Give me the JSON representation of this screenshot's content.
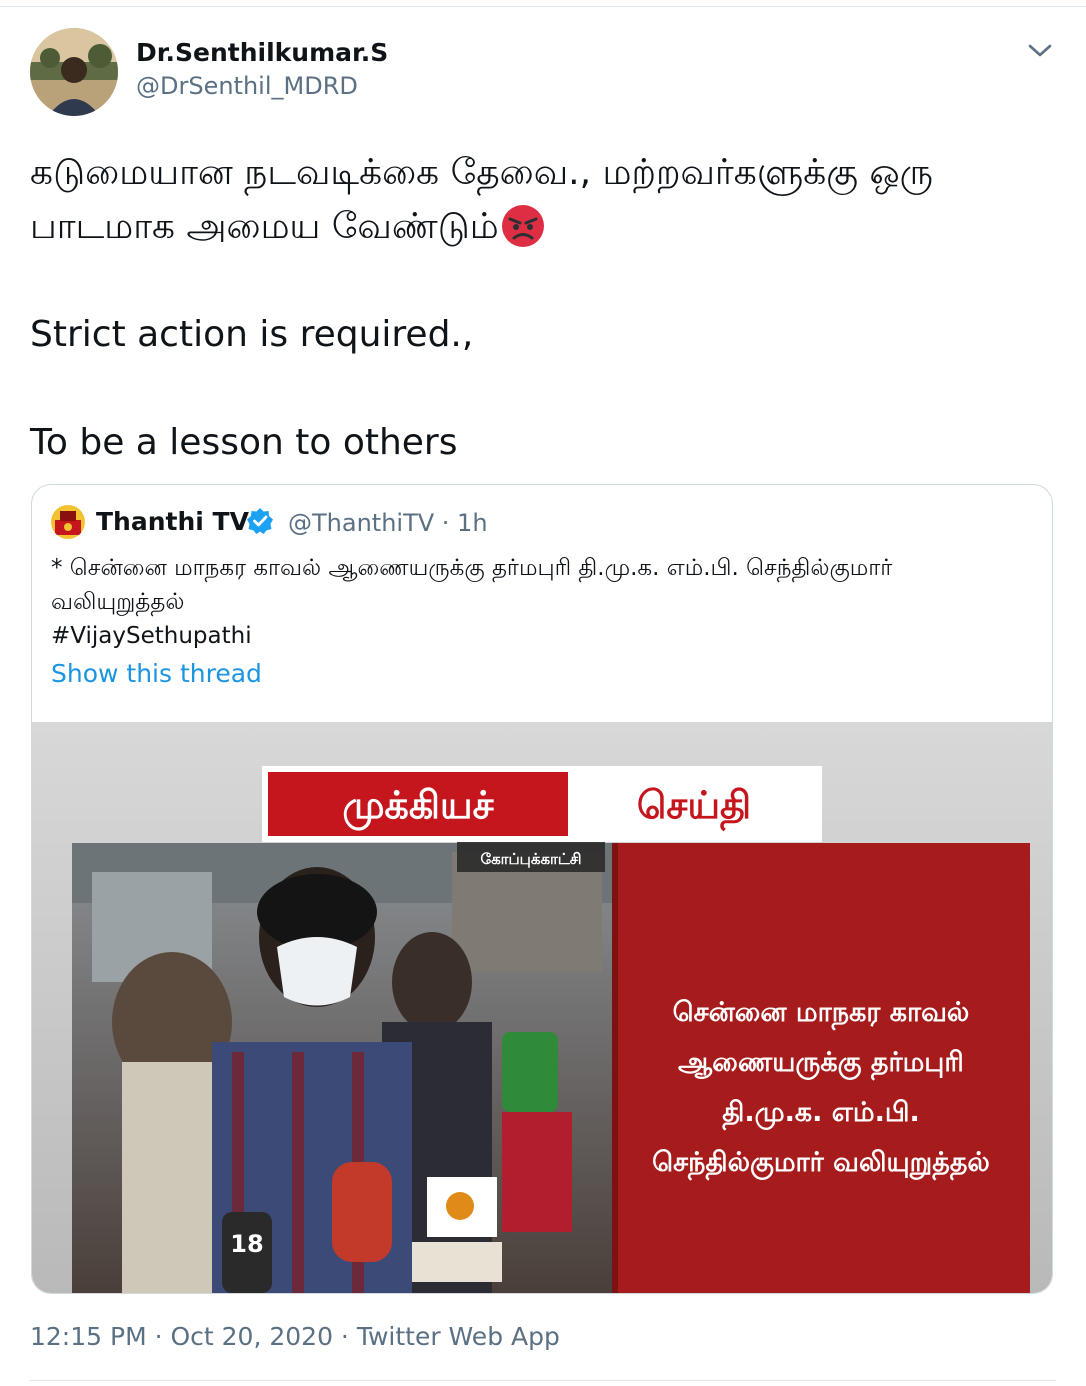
{
  "author": {
    "display_name": "Dr.Senthilkumar.S",
    "handle": "@DrSenthil_MDRD"
  },
  "tweet": {
    "tamil_line_1": "கடுமையான நடவடிக்கை தேவை., மற்றவர்களுக்கு ஒரு",
    "tamil_line_2": "பாடமாக அமைய வேண்டும்",
    "english_line_1": "Strict action is required.,",
    "english_line_2": "To be a lesson to others",
    "emoji": "angry-face"
  },
  "quoted": {
    "display_name": "Thanthi TV",
    "handle_time": "@ThanthiTV · 1h",
    "text_line_1": "* சென்னை மாநகர காவல் ஆணையருக்கு தர்மபுரி தி.மு.க. எம்.பி. செந்தில்குமார்",
    "text_line_2": "வலியுறுத்தல்",
    "hashtag": "#VijaySethupathi",
    "show_thread": "Show this thread",
    "media": {
      "banner_part_1": "முக்கியச்",
      "banner_part_2": "செய்தி",
      "archive_label": "கோப்புக்காட்சி",
      "caption_line_1": "சென்னை மாநகர காவல்",
      "caption_line_2": "ஆணையருக்கு தர்மபுரி",
      "caption_line_3": "தி.மு.க. எம்.பி.",
      "caption_line_4": "செந்தில்குமார் வலியுறுத்தல்",
      "mic_number": "18"
    }
  },
  "meta": {
    "line": "12:15 PM · Oct 20, 2020 · Twitter Web App"
  },
  "colors": {
    "link": "#1b95e0",
    "secondary_text": "#5b7083",
    "banner_red": "#c4161c",
    "panel_red": "#a61c1c"
  }
}
